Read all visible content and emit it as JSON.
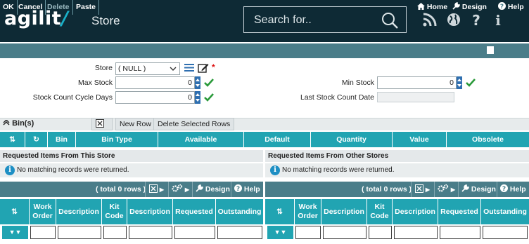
{
  "header": {
    "logo": "agilit",
    "title": "Store",
    "search_placeholder": "Search for.."
  },
  "toolbar": {
    "ok": "OK",
    "cancel": "Cancel",
    "delete": "Delete",
    "paste": "Paste",
    "home": "Home",
    "design": "Design",
    "help": "Help"
  },
  "form": {
    "store_label": "Store",
    "store_value": "( NULL )",
    "max_stock_label": "Max Stock",
    "max_stock_value": "0",
    "min_stock_label": "Min Stock",
    "min_stock_value": "0",
    "cycle_days_label": "Stock Count Cycle Days",
    "cycle_days_value": "0",
    "last_count_label": "Last Stock Count Date",
    "last_count_value": ""
  },
  "bins": {
    "title": "Bin(s)",
    "new_row": "New Row",
    "delete_rows": "Delete Selected Rows",
    "columns": [
      "Bin",
      "Bin Type",
      "Available",
      "Default",
      "Quantity",
      "Value",
      "Obsolete"
    ]
  },
  "requested_this": {
    "title": "Requested Items From This Store",
    "message": "No matching records were returned.",
    "total": "( total 0 rows )",
    "design": "Design",
    "help": "Help",
    "columns": [
      "Work Order",
      "Description",
      "Kit Code",
      "Description",
      "Requested",
      "Outstanding"
    ]
  },
  "requested_other": {
    "title": "Requested Items From Other Stores",
    "message": "No matching records were returned.",
    "total": "( total 0 rows )",
    "design": "Design",
    "help": "Help",
    "columns": [
      "Work Order",
      "Description",
      "Kit Code",
      "Description",
      "Requested",
      "Outstanding"
    ]
  },
  "colors": {
    "header_bg": "#0e2a35",
    "toolbar_bg": "#4a7d89",
    "grid_header": "#21a4b2",
    "accent": "#19b0c8"
  }
}
